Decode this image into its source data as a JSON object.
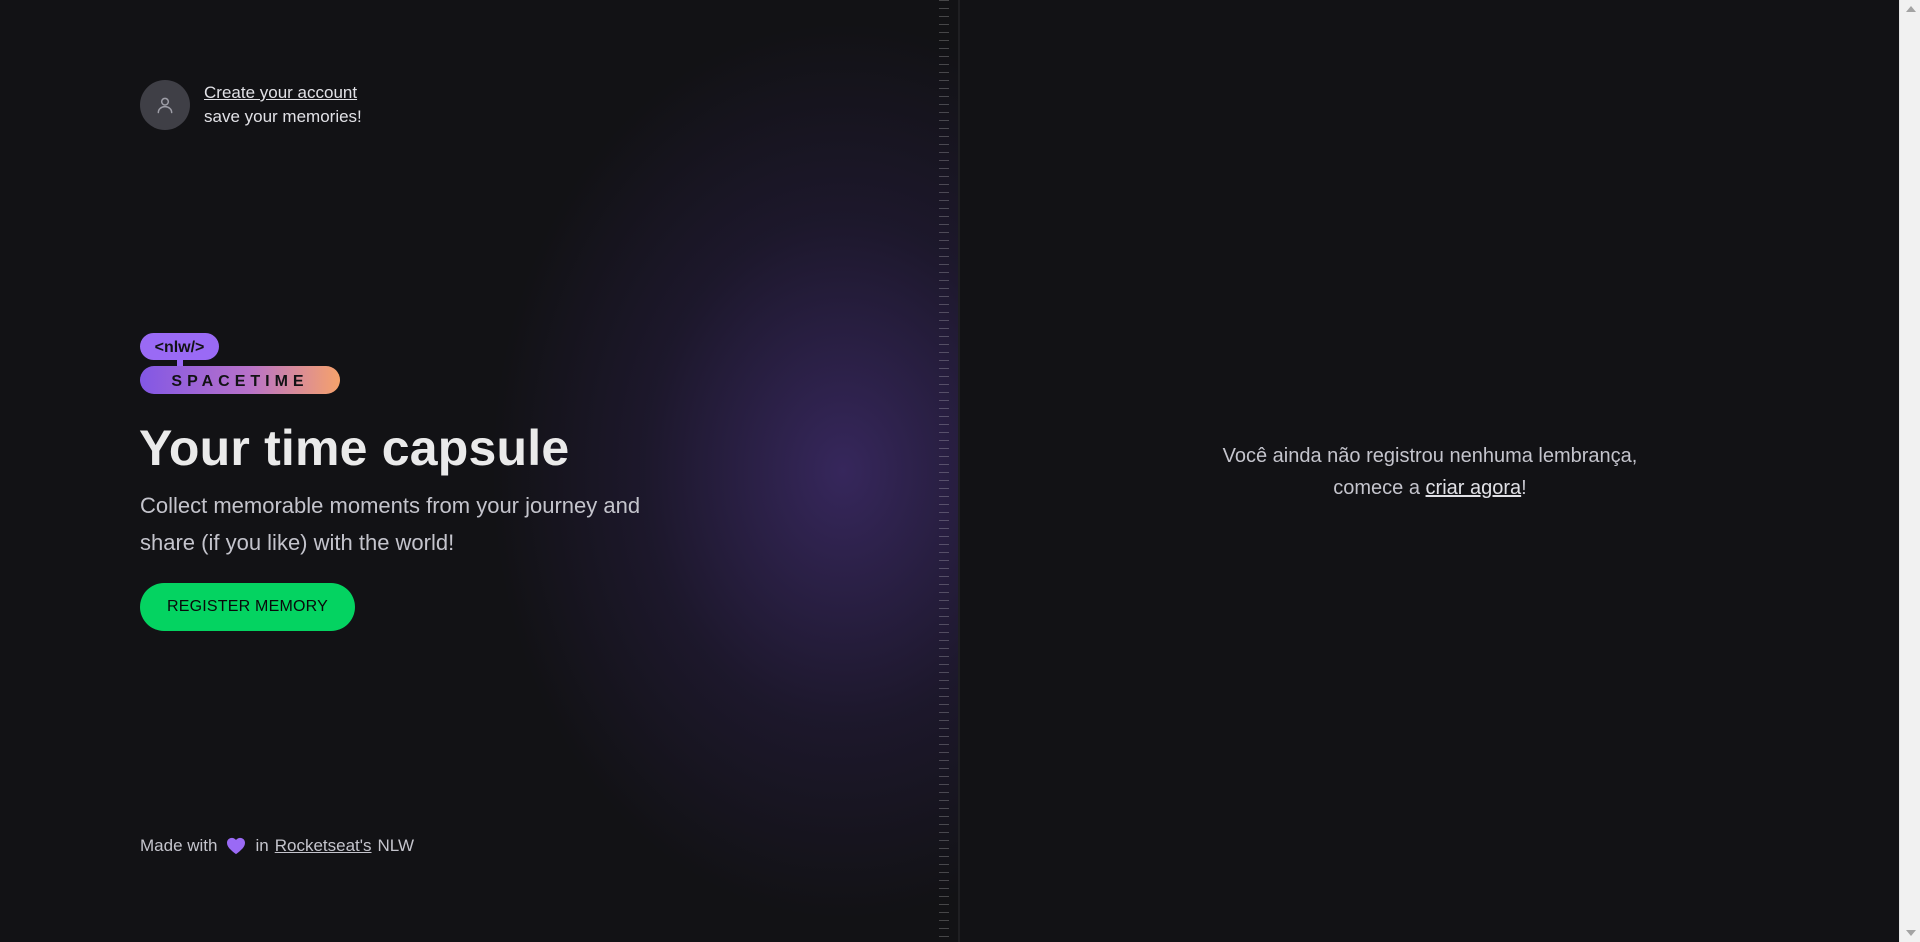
{
  "signin": {
    "link_text": "Create your account",
    "subtitle": "save your memories!",
    "avatar_icon": "user-icon"
  },
  "logo": {
    "tag_text": "<nlw/>",
    "wordmark": "SPACETIME",
    "gradient_start": "#8257e5",
    "gradient_end": "#f6a26b"
  },
  "hero": {
    "title": "Your time capsule",
    "description": "Collect memorable moments from your journey and share (if you like) with the world!",
    "cta_label": "REGISTER MEMORY",
    "cta_color": "#04d361"
  },
  "footer": {
    "made_with": "Made with",
    "heart_icon": "heart-icon",
    "in_text": "in",
    "link_text": "Rocketseat's",
    "suffix": "NLW",
    "heart_color": "#8257e5"
  },
  "empty_state": {
    "line1": "Você ainda não registrou nenhuma lembrança,",
    "line2_prefix": "comece a",
    "link_text": "criar agora",
    "line2_suffix": "!"
  },
  "scrollbar": {
    "up_icon": "scroll-up-arrow-icon",
    "down_icon": "scroll-down-arrow-icon"
  }
}
